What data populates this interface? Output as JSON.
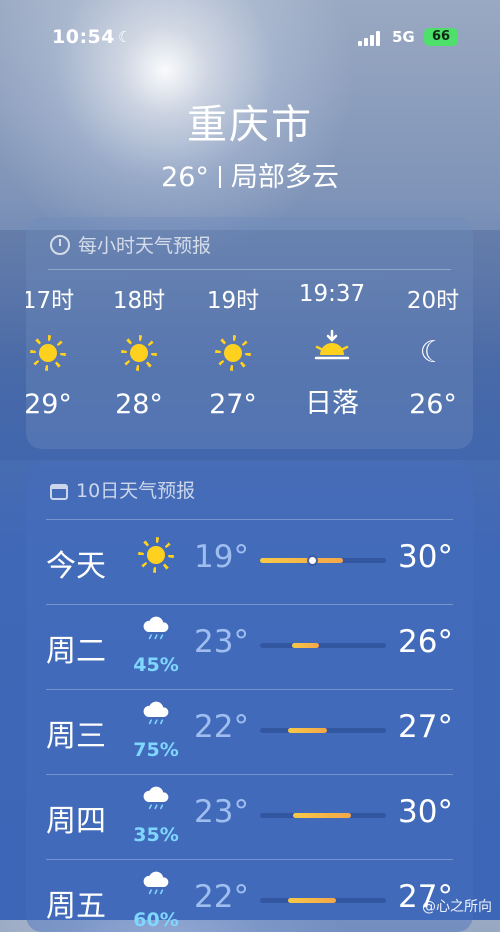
{
  "status_bar": {
    "time": "10:54",
    "network": "5G",
    "battery": "66"
  },
  "location": {
    "city": "重庆市",
    "temperature": "26°",
    "condition": "局部多云"
  },
  "hourly": {
    "title": "每小时天气预报",
    "items": [
      {
        "time": "17时",
        "icon": "sun-icon",
        "label": "29°"
      },
      {
        "time": "18时",
        "icon": "sun-icon",
        "label": "28°"
      },
      {
        "time": "19时",
        "icon": "sun-icon",
        "label": "27°"
      },
      {
        "time": "19:37",
        "icon": "sunset-icon",
        "label": "日落"
      },
      {
        "time": "20时",
        "icon": "moon-stars-icon",
        "label": "26°"
      }
    ]
  },
  "daily": {
    "title": "10日天气预报",
    "days": [
      {
        "name": "今天",
        "icon": "sun-icon",
        "precip": "",
        "low": "19°",
        "high": "30°",
        "range_start": 0.0,
        "range_end": 0.66,
        "current_marker": 0.41
      },
      {
        "name": "周二",
        "icon": "rain-cloud-icon",
        "precip": "45%",
        "low": "23°",
        "high": "26°",
        "range_start": 0.25,
        "range_end": 0.47
      },
      {
        "name": "周三",
        "icon": "rain-cloud-icon",
        "precip": "75%",
        "low": "22°",
        "high": "27°",
        "range_start": 0.22,
        "range_end": 0.53
      },
      {
        "name": "周四",
        "icon": "rain-cloud-icon",
        "precip": "35%",
        "low": "23°",
        "high": "30°",
        "range_start": 0.26,
        "range_end": 0.72
      },
      {
        "name": "周五",
        "icon": "rain-cloud-icon",
        "precip": "60%",
        "low": "22°",
        "high": "27°",
        "range_start": 0.22,
        "range_end": 0.6
      }
    ]
  },
  "watermark": "@心之所向"
}
